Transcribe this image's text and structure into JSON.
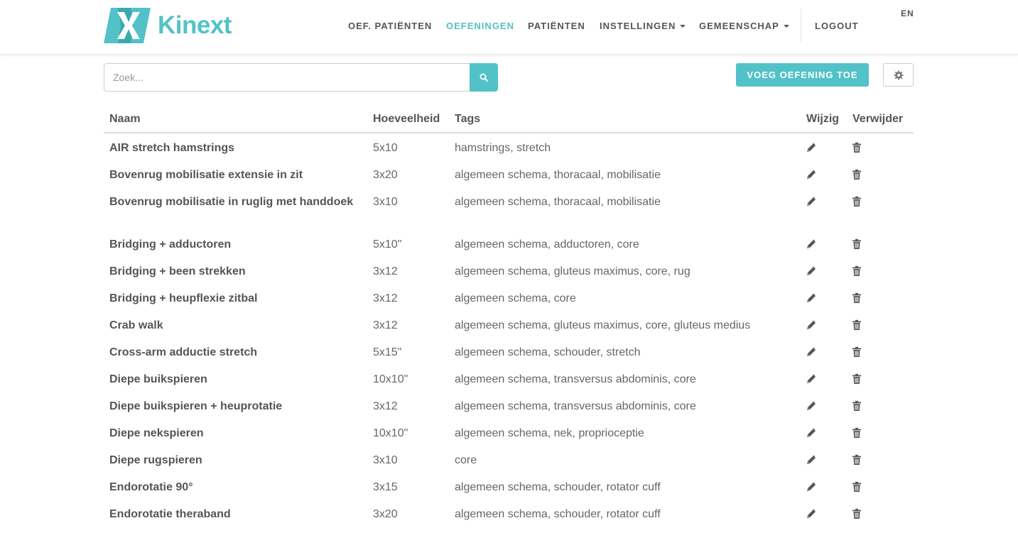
{
  "brand": {
    "name": "Kinext",
    "color": "#52c2c8"
  },
  "nav": {
    "items": [
      {
        "label": "OEF. PATIËNTEN",
        "active": false
      },
      {
        "label": "OEFENINGEN",
        "active": true
      },
      {
        "label": "PATIËNTEN",
        "active": false
      },
      {
        "label": "INSTELLINGEN",
        "active": false,
        "dropdown": true
      },
      {
        "label": "GEMEENSCHAP",
        "active": false,
        "dropdown": true
      }
    ],
    "logout": "LOGOUT",
    "language": "EN"
  },
  "toolbar": {
    "search_placeholder": "Zoek...",
    "search_icon": "search-icon",
    "add_label": "VOEG OEFENING TOE",
    "settings_icon": "gear-icon"
  },
  "table": {
    "headers": {
      "name": "Naam",
      "quantity": "Hoeveelheid",
      "tags": "Tags",
      "edit": "Wijzig",
      "delete": "Verwijder"
    },
    "edit_icon": "pencil-icon",
    "delete_icon": "trash-icon",
    "rows": [
      {
        "name": "AIR stretch hamstrings",
        "quantity": "5x10",
        "tags": "hamstrings, stretch"
      },
      {
        "name": "Bovenrug mobilisatie extensie in zit",
        "quantity": "3x20",
        "tags": "algemeen schema, thoracaal, mobilisatie"
      },
      {
        "name": "Bovenrug mobilisatie in ruglig met handdoek",
        "quantity": "3x10",
        "tags": "algemeen schema, thoracaal, mobilisatie"
      },
      {
        "name": "Bridging + adductoren",
        "quantity": "5x10\"",
        "tags": "algemeen schema, adductoren, core"
      },
      {
        "name": "Bridging + been strekken",
        "quantity": "3x12",
        "tags": "algemeen schema, gluteus maximus, core, rug"
      },
      {
        "name": "Bridging + heupflexie zitbal",
        "quantity": "3x12",
        "tags": "algemeen schema, core"
      },
      {
        "name": "Crab walk",
        "quantity": "3x12",
        "tags": "algemeen schema, gluteus maximus, core, gluteus medius"
      },
      {
        "name": "Cross-arm adductie stretch",
        "quantity": "5x15\"",
        "tags": "algemeen schema, schouder, stretch"
      },
      {
        "name": "Diepe buikspieren",
        "quantity": "10x10\"",
        "tags": "algemeen schema, transversus abdominis, core"
      },
      {
        "name": "Diepe buikspieren + heuprotatie",
        "quantity": "3x12",
        "tags": "algemeen schema, transversus abdominis, core"
      },
      {
        "name": "Diepe nekspieren",
        "quantity": "10x10\"",
        "tags": "algemeen schema, nek, proprioceptie"
      },
      {
        "name": "Diepe rugspieren",
        "quantity": "3x10",
        "tags": "core"
      },
      {
        "name": "Endorotatie 90°",
        "quantity": "3x15",
        "tags": "algemeen schema, schouder, rotator cuff"
      },
      {
        "name": "Endorotatie theraband",
        "quantity": "3x20",
        "tags": "algemeen schema, schouder, rotator cuff"
      }
    ]
  }
}
